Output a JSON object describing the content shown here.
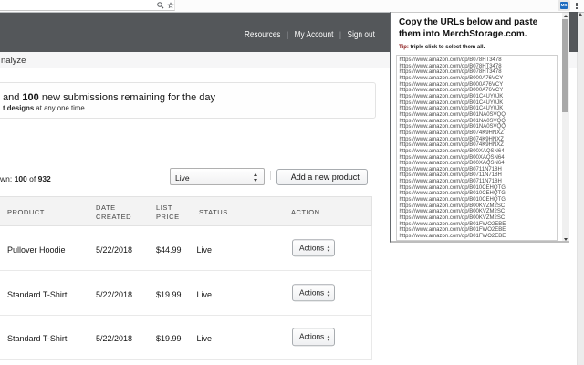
{
  "browser": {
    "extension_badge_text": "MS",
    "icons": {
      "zoom": "zoom-icon",
      "bookmark": "bookmark-star-icon",
      "extension": "merchstorage-extension-icon",
      "menu": "browser-menu-kebab-icon"
    }
  },
  "navbar": {
    "links": [
      "Resources",
      "My Account",
      "Sign out"
    ],
    "separator": "|"
  },
  "tabbar": {
    "active_tab_partial": "nalyze"
  },
  "banner": {
    "line1_prefix": " and ",
    "line1_bold": "100",
    "line1_suffix": " new submissions remaining for the day",
    "line2_bold": "t designs",
    "line2_suffix": " at any one time."
  },
  "controls": {
    "shown_prefix": "wn: ",
    "shown_count": "100",
    "shown_of": " of ",
    "shown_total": "932",
    "filter_value": "Live",
    "add_button_label": "Add a new product"
  },
  "table": {
    "headers": [
      "PRODUCT",
      "DATE CREATED",
      "LIST PRICE",
      "STATUS",
      "ACTION"
    ],
    "rows": [
      {
        "product": "Pullover Hoodie",
        "date_created": "5/22/2018",
        "list_price": "$44.99",
        "status": "Live",
        "action_label": "Actions"
      },
      {
        "product": "Standard T-Shirt",
        "date_created": "5/22/2018",
        "list_price": "$19.99",
        "status": "Live",
        "action_label": "Actions"
      },
      {
        "product": "Standard T-Shirt",
        "date_created": "5/22/2018",
        "list_price": "$19.99",
        "status": "Live",
        "action_label": "Actions"
      }
    ]
  },
  "popup": {
    "title": "Copy the URLs below and paste them into MerchStorage.com.",
    "tip_bold_label": "Tip:",
    "tip_text": " triple click to select them all.",
    "urls": [
      "https://www.amazon.com/dp/B078HT3478",
      "https://www.amazon.com/dp/B000A76VCY",
      "https://www.amazon.com/dp/B01C4UY0JK",
      "https://www.amazon.com/dp/B01NA0SVQQ",
      "https://www.amazon.com/dp/B074K9HNXZ",
      "https://www.amazon.com/dp/B00XAQSN64",
      "https://www.amazon.com/dp/B0711N718H",
      "https://www.amazon.com/dp/B010CEHQTG",
      "https://www.amazon.com/dp/B00KVZM2SC",
      "https://www.amazon.com/dp/B01FWO2EBE"
    ],
    "repeat_each": 3
  },
  "colors": {
    "navbar": "#54575a",
    "extension_icon_blue": "#1e6cc0",
    "tip_red": "#8b1a1a",
    "scrollbar_thumb_dark": "#4f5356"
  }
}
